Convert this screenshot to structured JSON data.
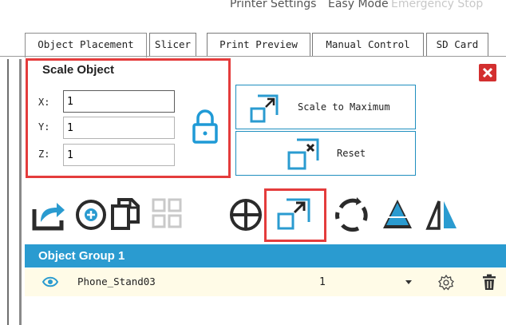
{
  "top_menu": {
    "printer_settings": "Printer Settings",
    "easy_mode": "Easy Mode",
    "emergency_stop": "Emergency Stop"
  },
  "tabs": [
    {
      "label": "Object Placement",
      "active": true
    },
    {
      "label": "Slicer",
      "active": false
    },
    {
      "label": "Print Preview",
      "active": false
    },
    {
      "label": "Manual Control",
      "active": false
    },
    {
      "label": "SD Card",
      "active": false
    }
  ],
  "scale_panel": {
    "title": "Scale Object",
    "x_label": "X:",
    "y_label": "Y:",
    "z_label": "Z:",
    "x_value": "1",
    "y_value": "1",
    "z_value": "1",
    "lock_icon": "lock-icon",
    "scale_max_label": "Scale to Maximum",
    "reset_label": "Reset"
  },
  "toolbar": {
    "icons": [
      "add-object-icon",
      "plus-circle-icon",
      "copy-icon",
      "grid-arrange-icon",
      "center-icon",
      "scale-icon",
      "rotate-icon",
      "cut-icon",
      "mirror-icon"
    ]
  },
  "object_group": {
    "title": "Object Group 1",
    "rows": [
      {
        "name": "Phone_Stand03",
        "copies": "1"
      }
    ]
  },
  "colors": {
    "accent": "#2a9bd0",
    "highlight": "#e43c3c",
    "close": "#d32f2f"
  }
}
